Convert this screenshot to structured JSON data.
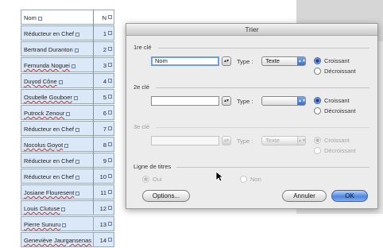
{
  "table": {
    "header": {
      "name": "Nom",
      "num": "N"
    },
    "rows": [
      {
        "name": "Réducteur en Chef",
        "num": "1"
      },
      {
        "name": "Bertrand Duranton",
        "num": "2"
      },
      {
        "name": "Fernunda Noguei",
        "num": "3"
      },
      {
        "name": "Duyod Cône",
        "num": "4"
      },
      {
        "name": "Osubelle Gouboer",
        "num": "5"
      },
      {
        "name": "Putrock Zenour",
        "num": "6"
      },
      {
        "name": "Réducteur en Chef",
        "num": "7"
      },
      {
        "name": "Nocolus Goyot",
        "num": "8"
      },
      {
        "name": "Réducteur en Chef",
        "num": "9"
      },
      {
        "name": "Réducteur en Chef",
        "num": "10"
      },
      {
        "name": "Josiane Flouresent",
        "num": "11"
      },
      {
        "name": "Louis Clutuse",
        "num": "12"
      },
      {
        "name": "Pierre Sunuru",
        "num": "13"
      },
      {
        "name": "Geneviève Jaurgansenas",
        "num": "14"
      }
    ]
  },
  "dialog": {
    "title": "Trier",
    "key1": {
      "section": "1re clé",
      "field_value": "Nom",
      "type_label": "Type :",
      "type_value": "Texte",
      "asc": "Croissant",
      "desc": "Décroissant"
    },
    "key2": {
      "section": "2e clé",
      "field_value": "",
      "type_label": "Type :",
      "type_value": "",
      "asc": "Croissant",
      "desc": "Décroissant"
    },
    "key3": {
      "section": "3e clé",
      "field_value": "",
      "type_label": "Type :",
      "type_value": "Texte",
      "asc": "Croissant",
      "desc": "Décroissant"
    },
    "titles": {
      "section": "Ligne de titres",
      "yes": "Oui",
      "no": "Non"
    },
    "buttons": {
      "options": "Options...",
      "cancel": "Annuler",
      "ok": "OK"
    }
  },
  "colors": {
    "accent": "#4f86dc",
    "cell_bg": "#dbe8f7"
  }
}
